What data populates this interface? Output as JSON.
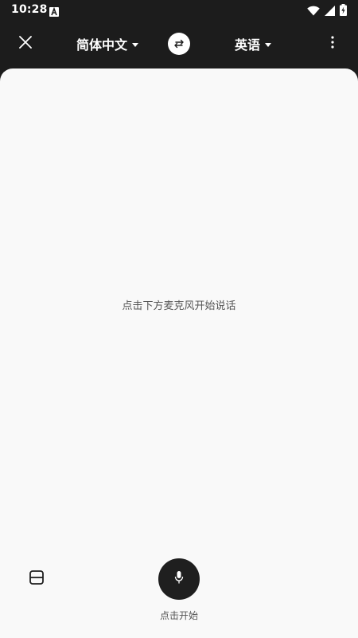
{
  "status_bar": {
    "time": "10:28",
    "notification_icon": "font-a-icon",
    "icons": [
      "wifi-icon",
      "signal-icon",
      "battery-charging-icon"
    ]
  },
  "app_bar": {
    "close_icon": "close-icon",
    "source_language": "简体中文",
    "swap_icon": "swap-arrows-icon",
    "target_language": "英语",
    "more_icon": "more-vertical-icon"
  },
  "main": {
    "hint_text": "点击下方麦克风开始说话"
  },
  "bottom": {
    "layout_icon": "split-layout-icon",
    "mic_icon": "microphone-icon",
    "mic_label": "点击开始"
  },
  "colors": {
    "topbar_bg": "#1c1c1c",
    "sheet_bg": "#f9f9f9",
    "mic_button_bg": "#1f1f1f",
    "hint_text": "#555555"
  }
}
